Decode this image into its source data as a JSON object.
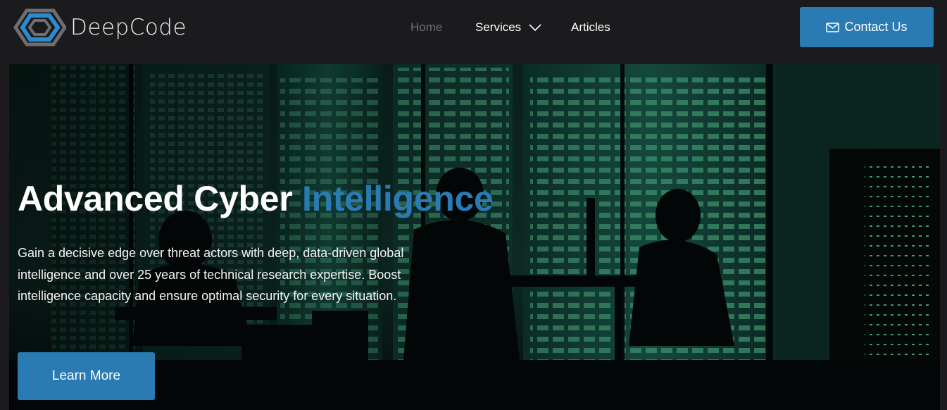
{
  "brand": {
    "name": "DeepCode"
  },
  "nav": {
    "items": [
      {
        "label": "Home",
        "active": true
      },
      {
        "label": "Services",
        "has_dropdown": true
      },
      {
        "label": "Articles"
      }
    ]
  },
  "header": {
    "contact_label": "Contact Us",
    "contact_icon": "mail-icon"
  },
  "hero": {
    "headline_main": "Advanced Cyber ",
    "headline_accent": "Intelligence",
    "description": "Gain a decisive edge over threat actors with deep, data-driven global intelligence and over 25 years of technical research expertise. Boost intelligence capacity and ensure optimal security for every situation.",
    "cta_label": "Learn More"
  },
  "colors": {
    "background": "#1b1a1d",
    "accent": "#2a7ab3",
    "nav_active": "#6f6f72",
    "text": "#ffffff"
  }
}
